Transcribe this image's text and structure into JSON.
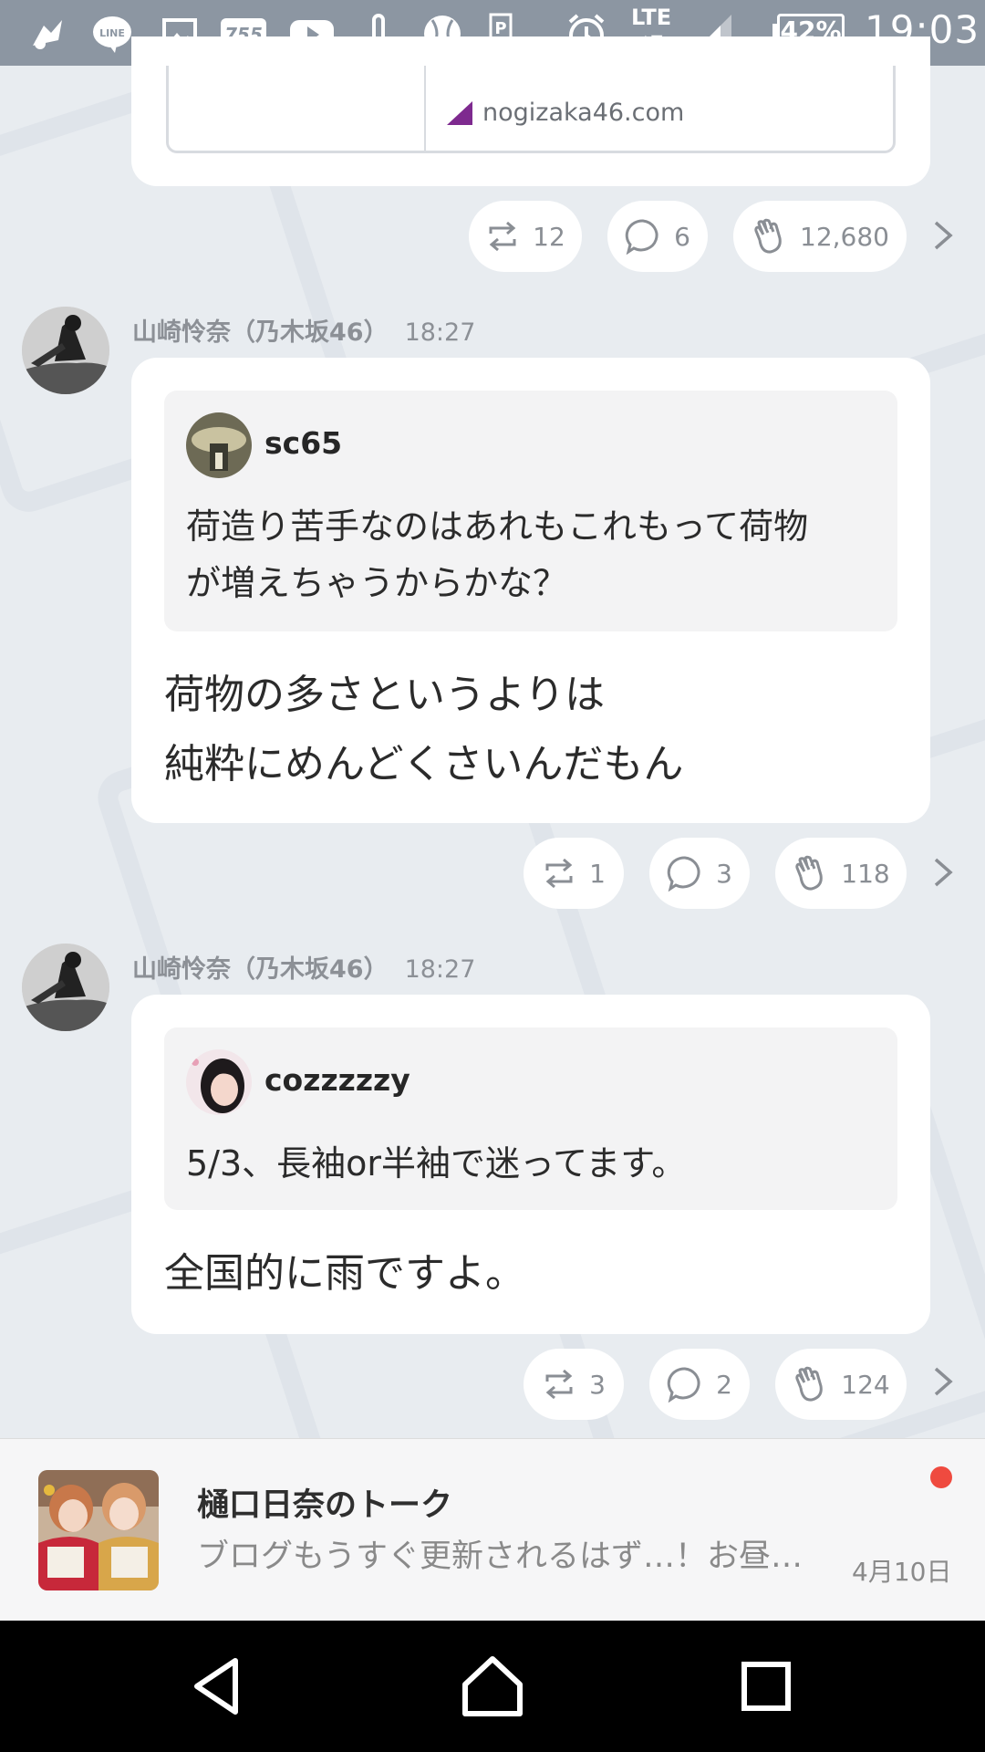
{
  "status_bar": {
    "icons": [
      "notification-app-icon",
      "line-icon",
      "image-icon",
      "755-icon",
      "youtube-icon",
      "thermometer-icon",
      "baseball-icon",
      "parking-icon",
      "alarm-icon",
      "lte-icon",
      "signal-icon"
    ],
    "lte_label": "LTE",
    "battery": "42%",
    "time": "19:03"
  },
  "link_card": {
    "domain": "nogizaka46.com"
  },
  "posts": [
    {
      "actions": {
        "repost": "12",
        "comment": "6",
        "clap": "12,680"
      }
    },
    {
      "author": "山崎怜奈（乃木坂46）",
      "time": "18:27",
      "quote_user": "sc65",
      "quote_line1": "荷造り苦手なのはあれもこれもって荷物",
      "quote_line2": "が増えちゃうからかな？",
      "reply_line1": "荷物の多さというよりは",
      "reply_line2": "純粋にめんどくさいんだもん",
      "actions": {
        "repost": "1",
        "comment": "3",
        "clap": "118"
      }
    },
    {
      "author": "山崎怜奈（乃木坂46）",
      "time": "18:27",
      "quote_user": "cozzzzzy",
      "quote_line1": "5/3、長袖or半袖で迷ってます。",
      "reply_line1": "全国的に雨ですよ。",
      "actions": {
        "repost": "3",
        "comment": "2",
        "clap": "124"
      }
    }
  ],
  "talk": {
    "title": "樋口日奈のトーク",
    "preview": "ブログもうすぐ更新されるはず…！お昼…",
    "date": "4月10日"
  },
  "colors": {
    "background": "#e8ecf0",
    "card": "#ffffff",
    "quote_bg": "#f3f3f4",
    "unread": "#ef4a3f",
    "status_bar": "#8c96a2"
  }
}
